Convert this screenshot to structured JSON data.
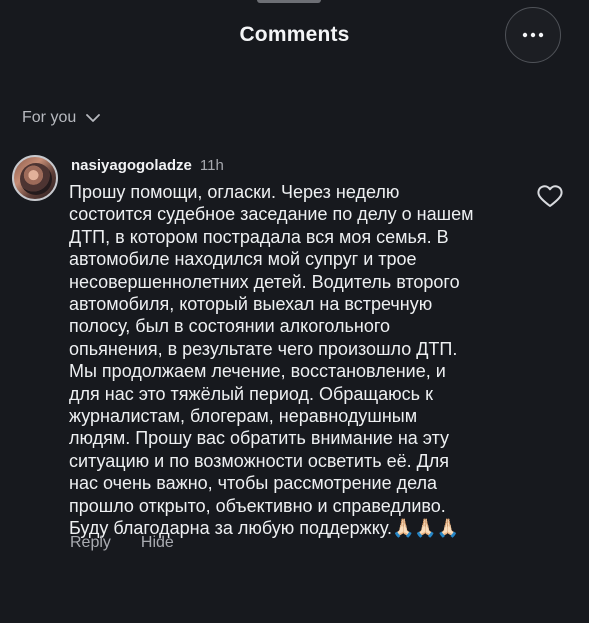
{
  "header": {
    "title": "Comments"
  },
  "filter": {
    "label": "For you"
  },
  "comment": {
    "username": "nasiyagogoladze",
    "time": "11h",
    "text": "Прошу помощи, огласки. Через неделю\nсостоится судебное заседание по делу о нашем\nДТП, в котором пострадала вся моя семья. В\nавтомобиле находился мой супруг и трое\nнесовершеннолетних детей. Водитель второго\nавтомобиля, который выехал на встречную\nполосу, был в состоянии алкогольного\nопьянения, в результате чего произошло ДТП.\nМы продолжаем лечение, восстановление, и\nдля нас это тяжёлый период. Обращаюсь к\nжурналистам, блогерам, неравнодушным\nлюдям. Прошу вас обратить внимание на эту\nситуацию и по возможности осветить её. Для\nнас очень важно, чтобы рассмотрение дела\nпрошло открыто, объективно и справедливо.\nБуду благодарна за любую поддержку.🙏🏻🙏🏻🙏🏻",
    "reply_label": "Reply",
    "hide_label": "Hide"
  },
  "icons": {
    "more": "more-horizontal-icon",
    "filter": "chevron-down-icon",
    "like": "heart-outline-icon"
  },
  "colors": {
    "background": "#17191e",
    "text": "#eef0f2",
    "muted": "#a9abb1"
  }
}
